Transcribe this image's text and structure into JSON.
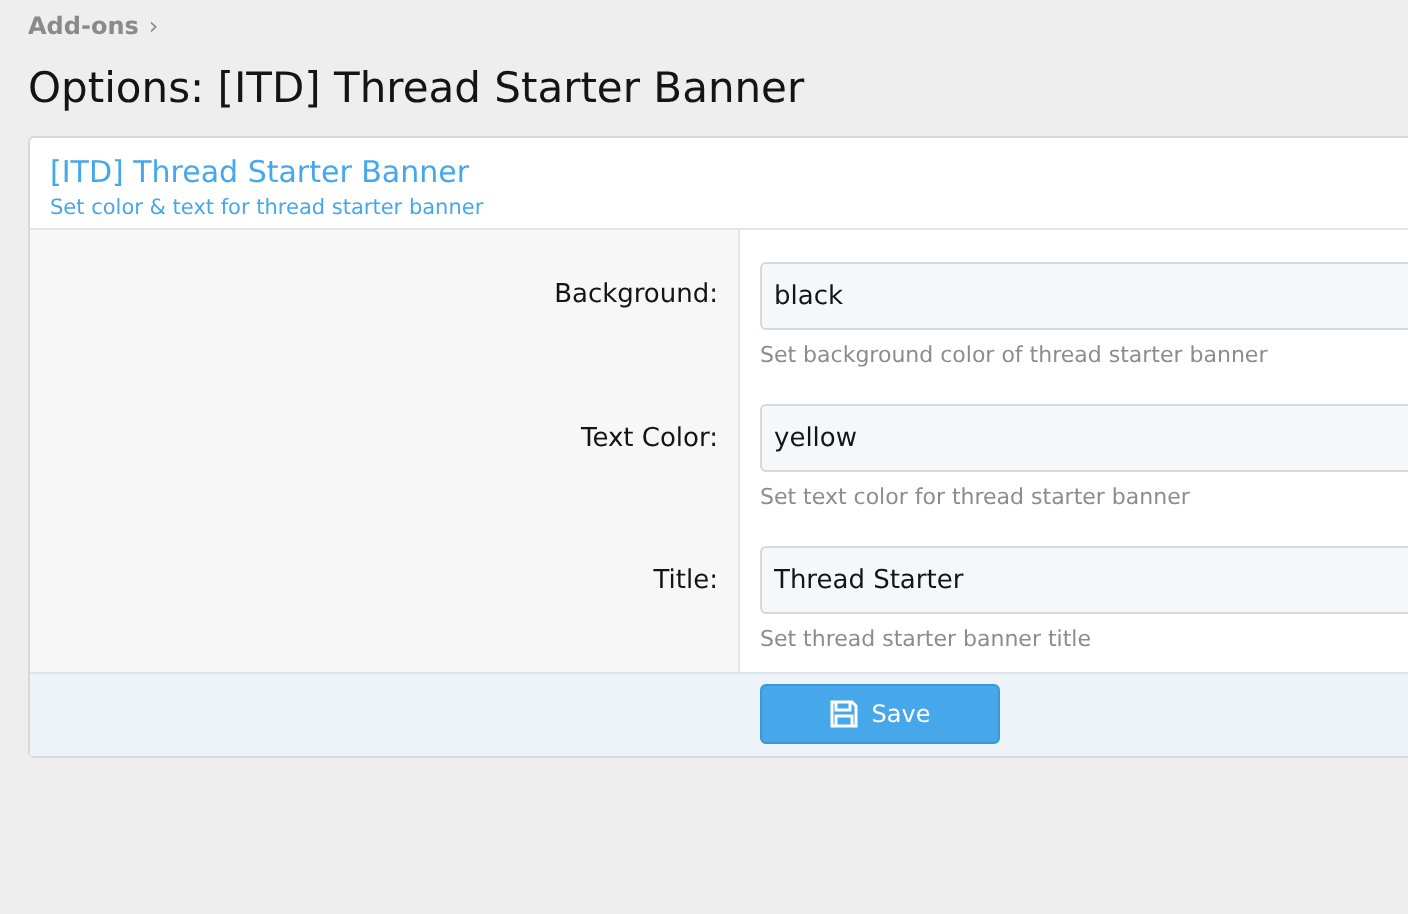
{
  "breadcrumb": {
    "label": "Add-ons",
    "separator": "›"
  },
  "page_title": "Options: [ITD] Thread Starter Banner",
  "panel": {
    "title": "[ITD] Thread Starter Banner",
    "description": "Set color & text for thread starter banner"
  },
  "options": [
    {
      "label": "Background:",
      "value": "black",
      "hint": "Set background color of thread starter banner"
    },
    {
      "label": "Text Color:",
      "value": "yellow",
      "hint": "Set text color for thread starter banner"
    },
    {
      "label": "Title:",
      "value": "Thread Starter",
      "hint": "Set thread starter banner title"
    }
  ],
  "save_button": {
    "label": "Save"
  }
}
